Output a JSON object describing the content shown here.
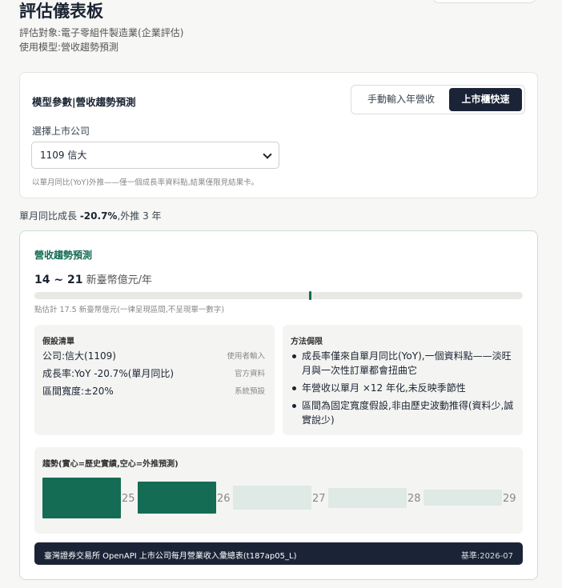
{
  "header": {
    "title": "評估儀表板",
    "target_line": "評估對象:電子零組件製造業(企業評估)",
    "model_line": "使用模型:營收趨勢預測"
  },
  "model_card": {
    "title": "模型參數|營收趨勢預測",
    "tabs": [
      {
        "label": "手動輸入年營收",
        "active": false
      },
      {
        "label": "上市櫃快速",
        "active": true
      }
    ],
    "select_label": "選擇上市公司",
    "selected_company": "1109 信大",
    "note": "以單月同比(YoY)外推——僅一個成長率資料點,結果僅限見結果卡。"
  },
  "growth_summary": {
    "prefix": "單月同比成長 ",
    "rate": "-20.7%",
    "suffix": ",外推 3 年"
  },
  "forecast": {
    "title": "營收趨勢預測",
    "range": "14 ~ 21",
    "unit": " 新臺幣億元/年",
    "point_estimate": 17.5,
    "range_low": 14,
    "range_high": 21,
    "note": "點估計 17.5 新臺幣億元(一律呈現區間,不呈現單一數字)",
    "assumptions": {
      "title": "假設清單",
      "items": [
        {
          "text": "公司:信大(1109)",
          "source": "使用者輸入"
        },
        {
          "text": "成長率:YoY -20.7%(單月同比)",
          "source": "官方資料"
        },
        {
          "text": "區間寬度:±20%",
          "source": "系統預設"
        }
      ]
    },
    "method": {
      "title": "方法侷限",
      "items": [
        "成長率僅來自單月同比(YoY),一個資料點——淡旺月與一次性訂單都會扭曲它",
        "年營收以單月 ×12 年化,未反映季節性",
        "區間為固定寬度假設,非由歷史波動推得(資料少,誠實說少)"
      ]
    },
    "trend": {
      "title": "趨勢(實心=歷史實績,空心=外推預測)"
    }
  },
  "chart_data": {
    "type": "bar",
    "title": "趨勢(實心=歷史實績,空心=外推預測)",
    "categories": [
      "25",
      "26",
      "27",
      "28",
      "29"
    ],
    "series": [
      {
        "name": "實心=歷史實績",
        "values": [
          null,
          null,
          null,
          null,
          null
        ]
      },
      {
        "name": "空心=外推預測",
        "values": [
          null,
          null,
          null,
          null,
          null
        ]
      }
    ],
    "bars": [
      {
        "label": "25",
        "kind": "hist",
        "relative": 1.0
      },
      {
        "label": "26",
        "kind": "hist",
        "relative": 0.79
      },
      {
        "label": "27",
        "kind": "proj",
        "relative": 0.63
      },
      {
        "label": "28",
        "kind": "proj",
        "relative": 0.5
      },
      {
        "label": "29",
        "kind": "proj",
        "relative": 0.39
      }
    ],
    "colors": {
      "hist": "#146c54",
      "proj": "#dfe9e5"
    },
    "legend": "none",
    "grid": false
  },
  "footer": {
    "source": "臺灣證券交易所 OpenAPI 上市公司每月營業收入彙總表(t187ap05_L)",
    "base": "基準:2026-07"
  }
}
